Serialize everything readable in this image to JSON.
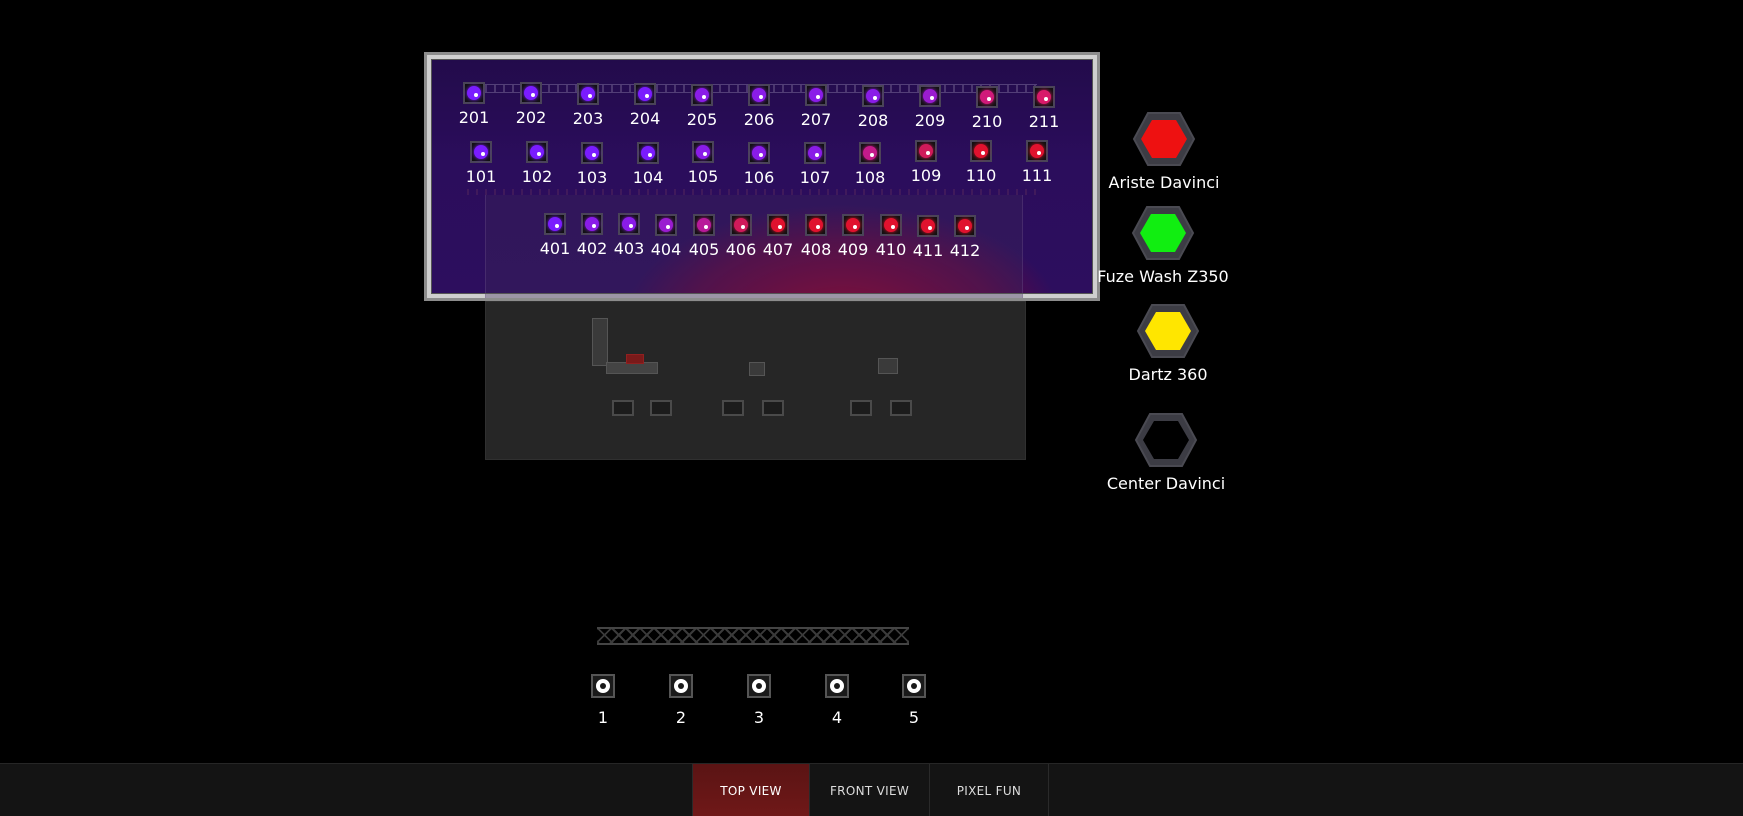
{
  "preview": {
    "top_row": [
      {
        "id": "201",
        "color": "#7a1cff"
      },
      {
        "id": "202",
        "color": "#7a1cff"
      },
      {
        "id": "203",
        "color": "#7a1cff"
      },
      {
        "id": "204",
        "color": "#7a1cff"
      },
      {
        "id": "205",
        "color": "#8a1ce8"
      },
      {
        "id": "206",
        "color": "#8a1ce8"
      },
      {
        "id": "207",
        "color": "#8a1ce8"
      },
      {
        "id": "208",
        "color": "#8a1ce8"
      },
      {
        "id": "209",
        "color": "#9a1cd0"
      },
      {
        "id": "210",
        "color": "#d01a7a"
      },
      {
        "id": "211",
        "color": "#d81a6a"
      }
    ],
    "mid_row": [
      {
        "id": "101",
        "color": "#7a1cff"
      },
      {
        "id": "102",
        "color": "#7a1cff"
      },
      {
        "id": "103",
        "color": "#7a1cff"
      },
      {
        "id": "104",
        "color": "#7a1cff"
      },
      {
        "id": "105",
        "color": "#8a1ce8"
      },
      {
        "id": "106",
        "color": "#8a1ce8"
      },
      {
        "id": "107",
        "color": "#8a1ce8"
      },
      {
        "id": "108",
        "color": "#c41a8a"
      },
      {
        "id": "109",
        "color": "#d01a5a"
      },
      {
        "id": "110",
        "color": "#e0122e"
      },
      {
        "id": "111",
        "color": "#e0122e"
      }
    ],
    "bottom_row": [
      {
        "id": "401",
        "color": "#7a1cff"
      },
      {
        "id": "402",
        "color": "#8a1ce8"
      },
      {
        "id": "403",
        "color": "#8a1ce8"
      },
      {
        "id": "404",
        "color": "#9a1cd0"
      },
      {
        "id": "405",
        "color": "#b81a9a"
      },
      {
        "id": "406",
        "color": "#d01a5a"
      },
      {
        "id": "407",
        "color": "#e0122e"
      },
      {
        "id": "408",
        "color": "#e0122e"
      },
      {
        "id": "409",
        "color": "#e0122e"
      },
      {
        "id": "410",
        "color": "#e0122e"
      },
      {
        "id": "411",
        "color": "#e0122e"
      },
      {
        "id": "412",
        "color": "#e0122e"
      }
    ]
  },
  "floor_lamps": [
    "1",
    "2",
    "3",
    "4",
    "5"
  ],
  "legend": [
    {
      "label": "Ariste Davinci",
      "color": "#ee1111"
    },
    {
      "label": "Fuze Wash Z350",
      "color": "#11ee11"
    },
    {
      "label": "Dartz 360",
      "color": "#ffe600"
    },
    {
      "label": "Center Davinci",
      "color": ""
    }
  ],
  "nav": {
    "tabs": [
      "TOP VIEW",
      "FRONT VIEW",
      "PIXEL FUN"
    ],
    "active": "TOP VIEW"
  }
}
